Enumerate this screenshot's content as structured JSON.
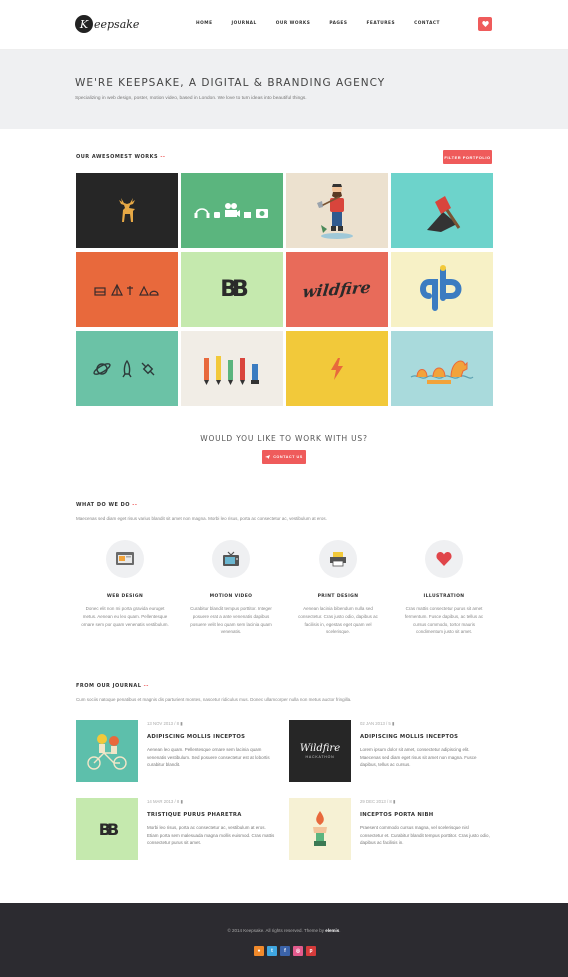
{
  "header": {
    "logo_letter": "K",
    "logo_text": "eepsake",
    "nav": [
      "HOME",
      "JOURNAL",
      "OUR WORKS",
      "PAGES",
      "FEATURES",
      "CONTACT"
    ]
  },
  "hero": {
    "title": "WE'RE KEEPSAKE, A DIGITAL & BRANDING AGENCY",
    "subtitle": "Specializing in web design, poster, motion video, based in London. We love to turn ideas into beautiful things."
  },
  "works": {
    "title": "OUR AWESOMEST WORKS",
    "dash": "--",
    "filter_label": "FILTER PORTFOLIO",
    "tiles": [
      {
        "color": "#262626",
        "icon": "deer-icon"
      },
      {
        "color": "#5bb57e",
        "icon": "media-devices-icon"
      },
      {
        "color": "#ece1cf",
        "icon": "lumberjack-icon"
      },
      {
        "color": "#6dd3cb",
        "icon": "axe-laptop-icon"
      },
      {
        "color": "#e8693c",
        "icon": "camping-icons"
      },
      {
        "color": "#c5e9ae",
        "icon": "bb-logo-icon"
      },
      {
        "color": "#e86b5a",
        "icon": "wildfire-lettering"
      },
      {
        "color": "#f7f1c6",
        "icon": "dp-monogram-icon"
      },
      {
        "color": "#6bc2a6",
        "icon": "space-icons"
      },
      {
        "color": "#f1ede6",
        "icon": "pencils-icon"
      },
      {
        "color": "#f2c93a",
        "icon": "lightning-icon"
      },
      {
        "color": "#a9dadc",
        "icon": "sea-monster-icon"
      }
    ],
    "tile_text_bb": "BB",
    "tile_text_wildfire": "wildfire"
  },
  "cta": {
    "title": "WOULD YOU LIKE TO WORK WITH US?",
    "button": "CONTACT US"
  },
  "services": {
    "title": "WHAT DO WE DO",
    "dash": "--",
    "desc": "Maecenas sed diam eget risus varius blandit sit amet non magna. Morbi leo risus, porta ac consectetur ac, vestibulum at eros.",
    "items": [
      {
        "title": "WEB DESIGN",
        "icon": "browser-icon",
        "text": "Donec elit non mi porta gravida euruget metus. Aenean eu leo quam. Pellentesque ornare sem por quam venenatis vestibulum."
      },
      {
        "title": "MOTION VIDEO",
        "icon": "tv-icon",
        "text": "Curabitur blandit tempus porttitor. Integer posuere erat a ante venenatis dapibus posuere velit leo quam sem lacinia quam venenatis."
      },
      {
        "title": "PRINT DESIGN",
        "icon": "printer-icon",
        "text": "Aenean lacinia bibendum nulla sed consectetur. Cras justo odio, dapibus ac facilisis in, egestas eget quam vel scelerisque."
      },
      {
        "title": "ILLUSTRATION",
        "icon": "heart-icon",
        "text": "Cras mattis consectetur purus sit amet fermentum. Fusce dapibus, ac tellus ac cursus commodo, tortor mauris condimentum justo sit amet."
      }
    ]
  },
  "journal": {
    "title": "FROM OUR JOURNAL",
    "dash": "--",
    "desc": "Cum sociis natoque penatibus et magnis dis parturient montes, nascetur ridiculus mus. Donec ullamcorper nulla non metus auctor fringilla.",
    "posts": [
      {
        "meta": "13 NOV 2013  /  8",
        "title": "ADIPISCING MOLLIS INCEPTOS",
        "text": "Aenean leo quam. Pellentesque ornare sem lacinia quam venenatis vestibulum. Sed posuere consectetur est at lobortis curabitur blandit.",
        "thumb_color": "#5dbfab"
      },
      {
        "meta": "02 JAN 2013  /  5",
        "title": "ADIPISCING MOLLIS INCEPTOS",
        "text": "Lorem ipsum dolor sit amet, consectetur adipiscing elit. Maecenas sed diam eget risus sit amet non magna. Fusce dapibus, tellus ac cursus.",
        "thumb_color": "#262626"
      },
      {
        "meta": "14 MAR 2013  /  8",
        "title": "TRISTIQUE PURUS PHARETRA",
        "text": "Morbi leo risus, porta ac consectetur ac, vestibulum at eros. Etiam porta sem malesuada magna mollis euismod. Cras mattis consectetur purus sit amet.",
        "thumb_color": "#c5e9ae"
      },
      {
        "meta": "29 DEC 2013  /  8",
        "title": "INCEPTOS PORTA NIBH",
        "text": "Praesent commodo cursus magna, vel scelerisque nisl consectetur et. Curabitur blandit tempus porttitor. Cras justo odio, dapibus ac facilisis in.",
        "thumb_color": "#f6f1d4"
      }
    ],
    "thumb_text_bb": "BB",
    "thumb_text_wildfire": "Wildfire",
    "thumb_text_wildfire_sub": "HACKATHON"
  },
  "footer": {
    "copy": "© 2014 Keepsake. All rights reserved. Theme by ",
    "author": "elemis",
    "period": ".",
    "socials": [
      {
        "name": "rss",
        "color": "#f18a2b",
        "glyph": "●"
      },
      {
        "name": "twitter",
        "color": "#3fa6e0",
        "glyph": "t"
      },
      {
        "name": "facebook",
        "color": "#3b63a9",
        "glyph": "f"
      },
      {
        "name": "dribbble",
        "color": "#e25b8d",
        "glyph": "◎"
      },
      {
        "name": "pinterest",
        "color": "#d53b3b",
        "glyph": "p"
      }
    ]
  }
}
